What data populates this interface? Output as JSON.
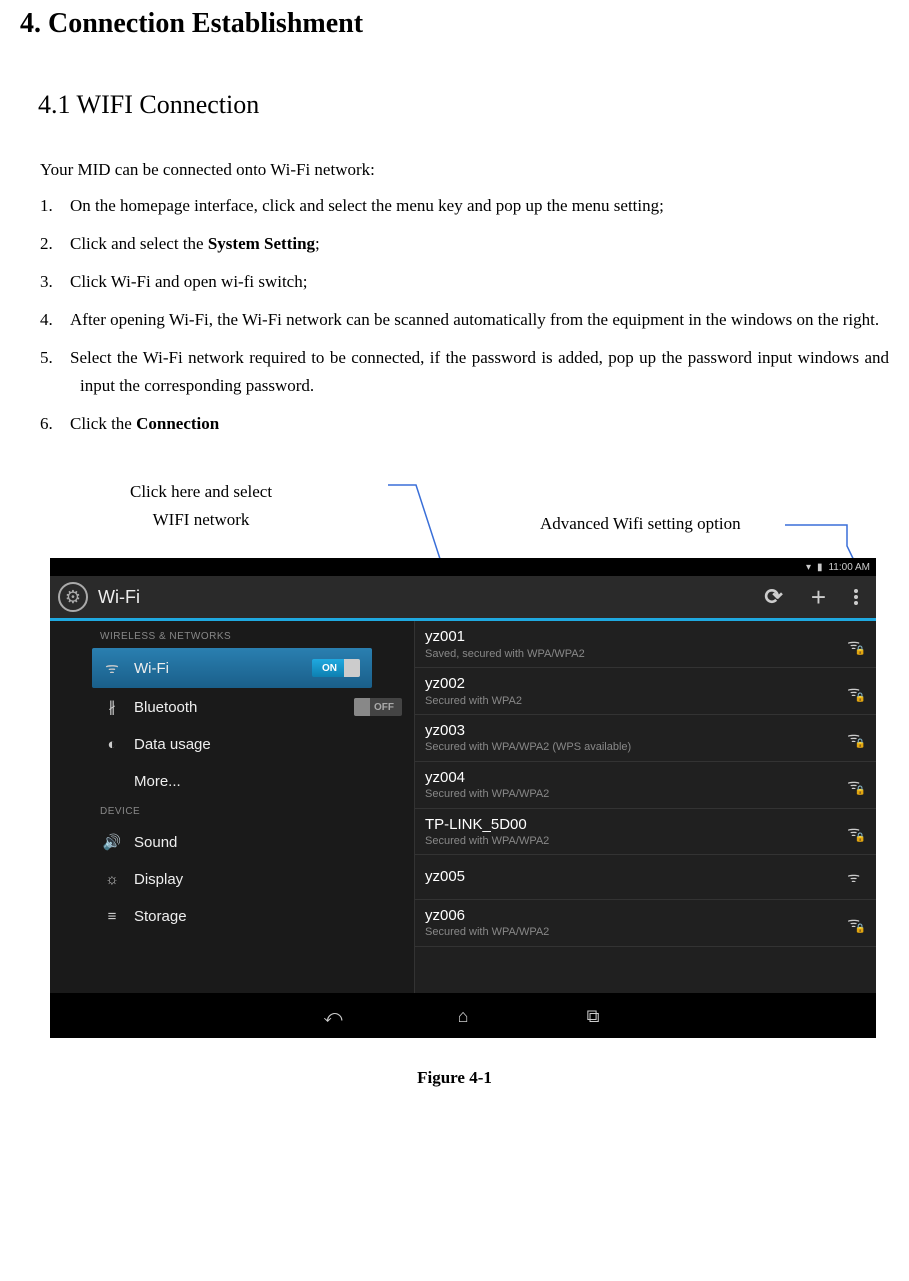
{
  "heading": "4. Connection Establishment",
  "subheading": "4.1 WIFI Connection",
  "intro": "Your MID can be connected onto Wi-Fi network:",
  "steps": [
    {
      "num": "1.",
      "text": "On the homepage interface, click and select the menu key and pop up the menu setting;"
    },
    {
      "num": "2.",
      "text_before": "Click and select the ",
      "bold": "System Setting",
      "text_after": ";"
    },
    {
      "num": "3.",
      "text": "Click Wi-Fi and open wi-fi switch;"
    },
    {
      "num": "4.",
      "text": "After opening Wi-Fi, the Wi-Fi network can be scanned automatically from the equipment in the windows on the right."
    },
    {
      "num": "5.",
      "text": "Select the Wi-Fi network required to be connected, if the password is added, pop up the password input windows and input the corresponding password."
    },
    {
      "num": "6.",
      "text_before": "Click the ",
      "bold": "Connection",
      "text_after": ""
    }
  ],
  "callouts": {
    "left_line1": "Click here and select",
    "left_line2": "WIFI network",
    "right": "Advanced Wifi setting option"
  },
  "screenshot": {
    "status_time": "11:00 AM",
    "header_title": "Wi-Fi",
    "sidebar": {
      "section1_label": "WIRELESS & NETWORKS",
      "section2_label": "DEVICE",
      "items_wireless": [
        {
          "icon": "wifi",
          "label": "Wi-Fi",
          "toggle": "ON",
          "active": true
        },
        {
          "icon": "bluetooth",
          "label": "Bluetooth",
          "toggle": "OFF"
        },
        {
          "icon": "data",
          "label": "Data usage"
        },
        {
          "icon": "",
          "label": "More..."
        }
      ],
      "items_device": [
        {
          "icon": "sound",
          "label": "Sound"
        },
        {
          "icon": "display",
          "label": "Display"
        },
        {
          "icon": "storage",
          "label": "Storage"
        }
      ]
    },
    "networks": [
      {
        "name": "yz001",
        "sub": "Saved, secured with WPA/WPA2",
        "locked": true
      },
      {
        "name": "yz002",
        "sub": "Secured with WPA2",
        "locked": true
      },
      {
        "name": "yz003",
        "sub": "Secured with WPA/WPA2 (WPS available)",
        "locked": true
      },
      {
        "name": "yz004",
        "sub": "Secured with WPA/WPA2",
        "locked": true
      },
      {
        "name": "TP-LINK_5D00",
        "sub": "Secured with WPA/WPA2",
        "locked": true
      },
      {
        "name": "yz005",
        "sub": "",
        "locked": false
      },
      {
        "name": "yz006",
        "sub": "Secured with WPA/WPA2",
        "locked": true
      }
    ]
  },
  "figure_caption": "Figure   4-1"
}
